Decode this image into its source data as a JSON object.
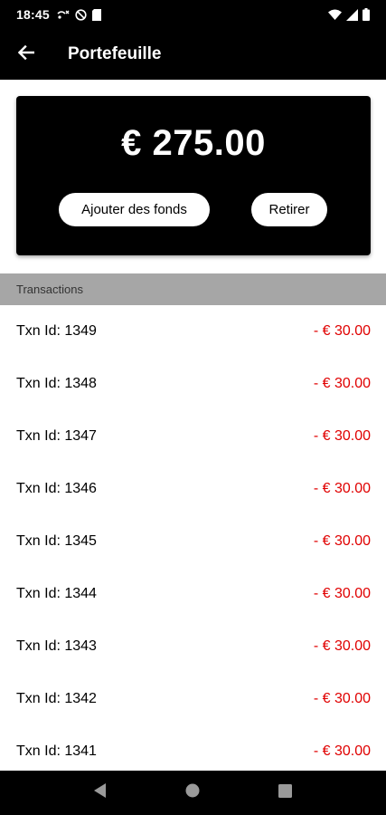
{
  "status_bar": {
    "time": "18:45",
    "icons": [
      "wifi-call-icon",
      "blocked-icon",
      "sim-card-icon",
      "wifi-icon",
      "signal-icon",
      "battery-icon"
    ]
  },
  "app_bar": {
    "title": "Portefeuille",
    "back_icon": "arrow-left-icon"
  },
  "wallet": {
    "balance": "€ 275.00",
    "add_funds_label": "Ajouter des fonds",
    "withdraw_label": "Retirer"
  },
  "transactions": {
    "header": "Transactions",
    "items": [
      {
        "id": "Txn Id: 1349",
        "amount": "- € 30.00"
      },
      {
        "id": "Txn Id: 1348",
        "amount": "- € 30.00"
      },
      {
        "id": "Txn Id: 1347",
        "amount": "- € 30.00"
      },
      {
        "id": "Txn Id: 1346",
        "amount": "- € 30.00"
      },
      {
        "id": "Txn Id: 1345",
        "amount": "- € 30.00"
      },
      {
        "id": "Txn Id: 1344",
        "amount": "- € 30.00"
      },
      {
        "id": "Txn Id: 1343",
        "amount": "- € 30.00"
      },
      {
        "id": "Txn Id: 1342",
        "amount": "- € 30.00"
      },
      {
        "id": "Txn Id: 1341",
        "amount": "- € 30.00"
      }
    ]
  },
  "colors": {
    "app_bar": "#000000",
    "card": "#000000",
    "section_header": "#a6a6a6",
    "amount": "#e00000"
  }
}
